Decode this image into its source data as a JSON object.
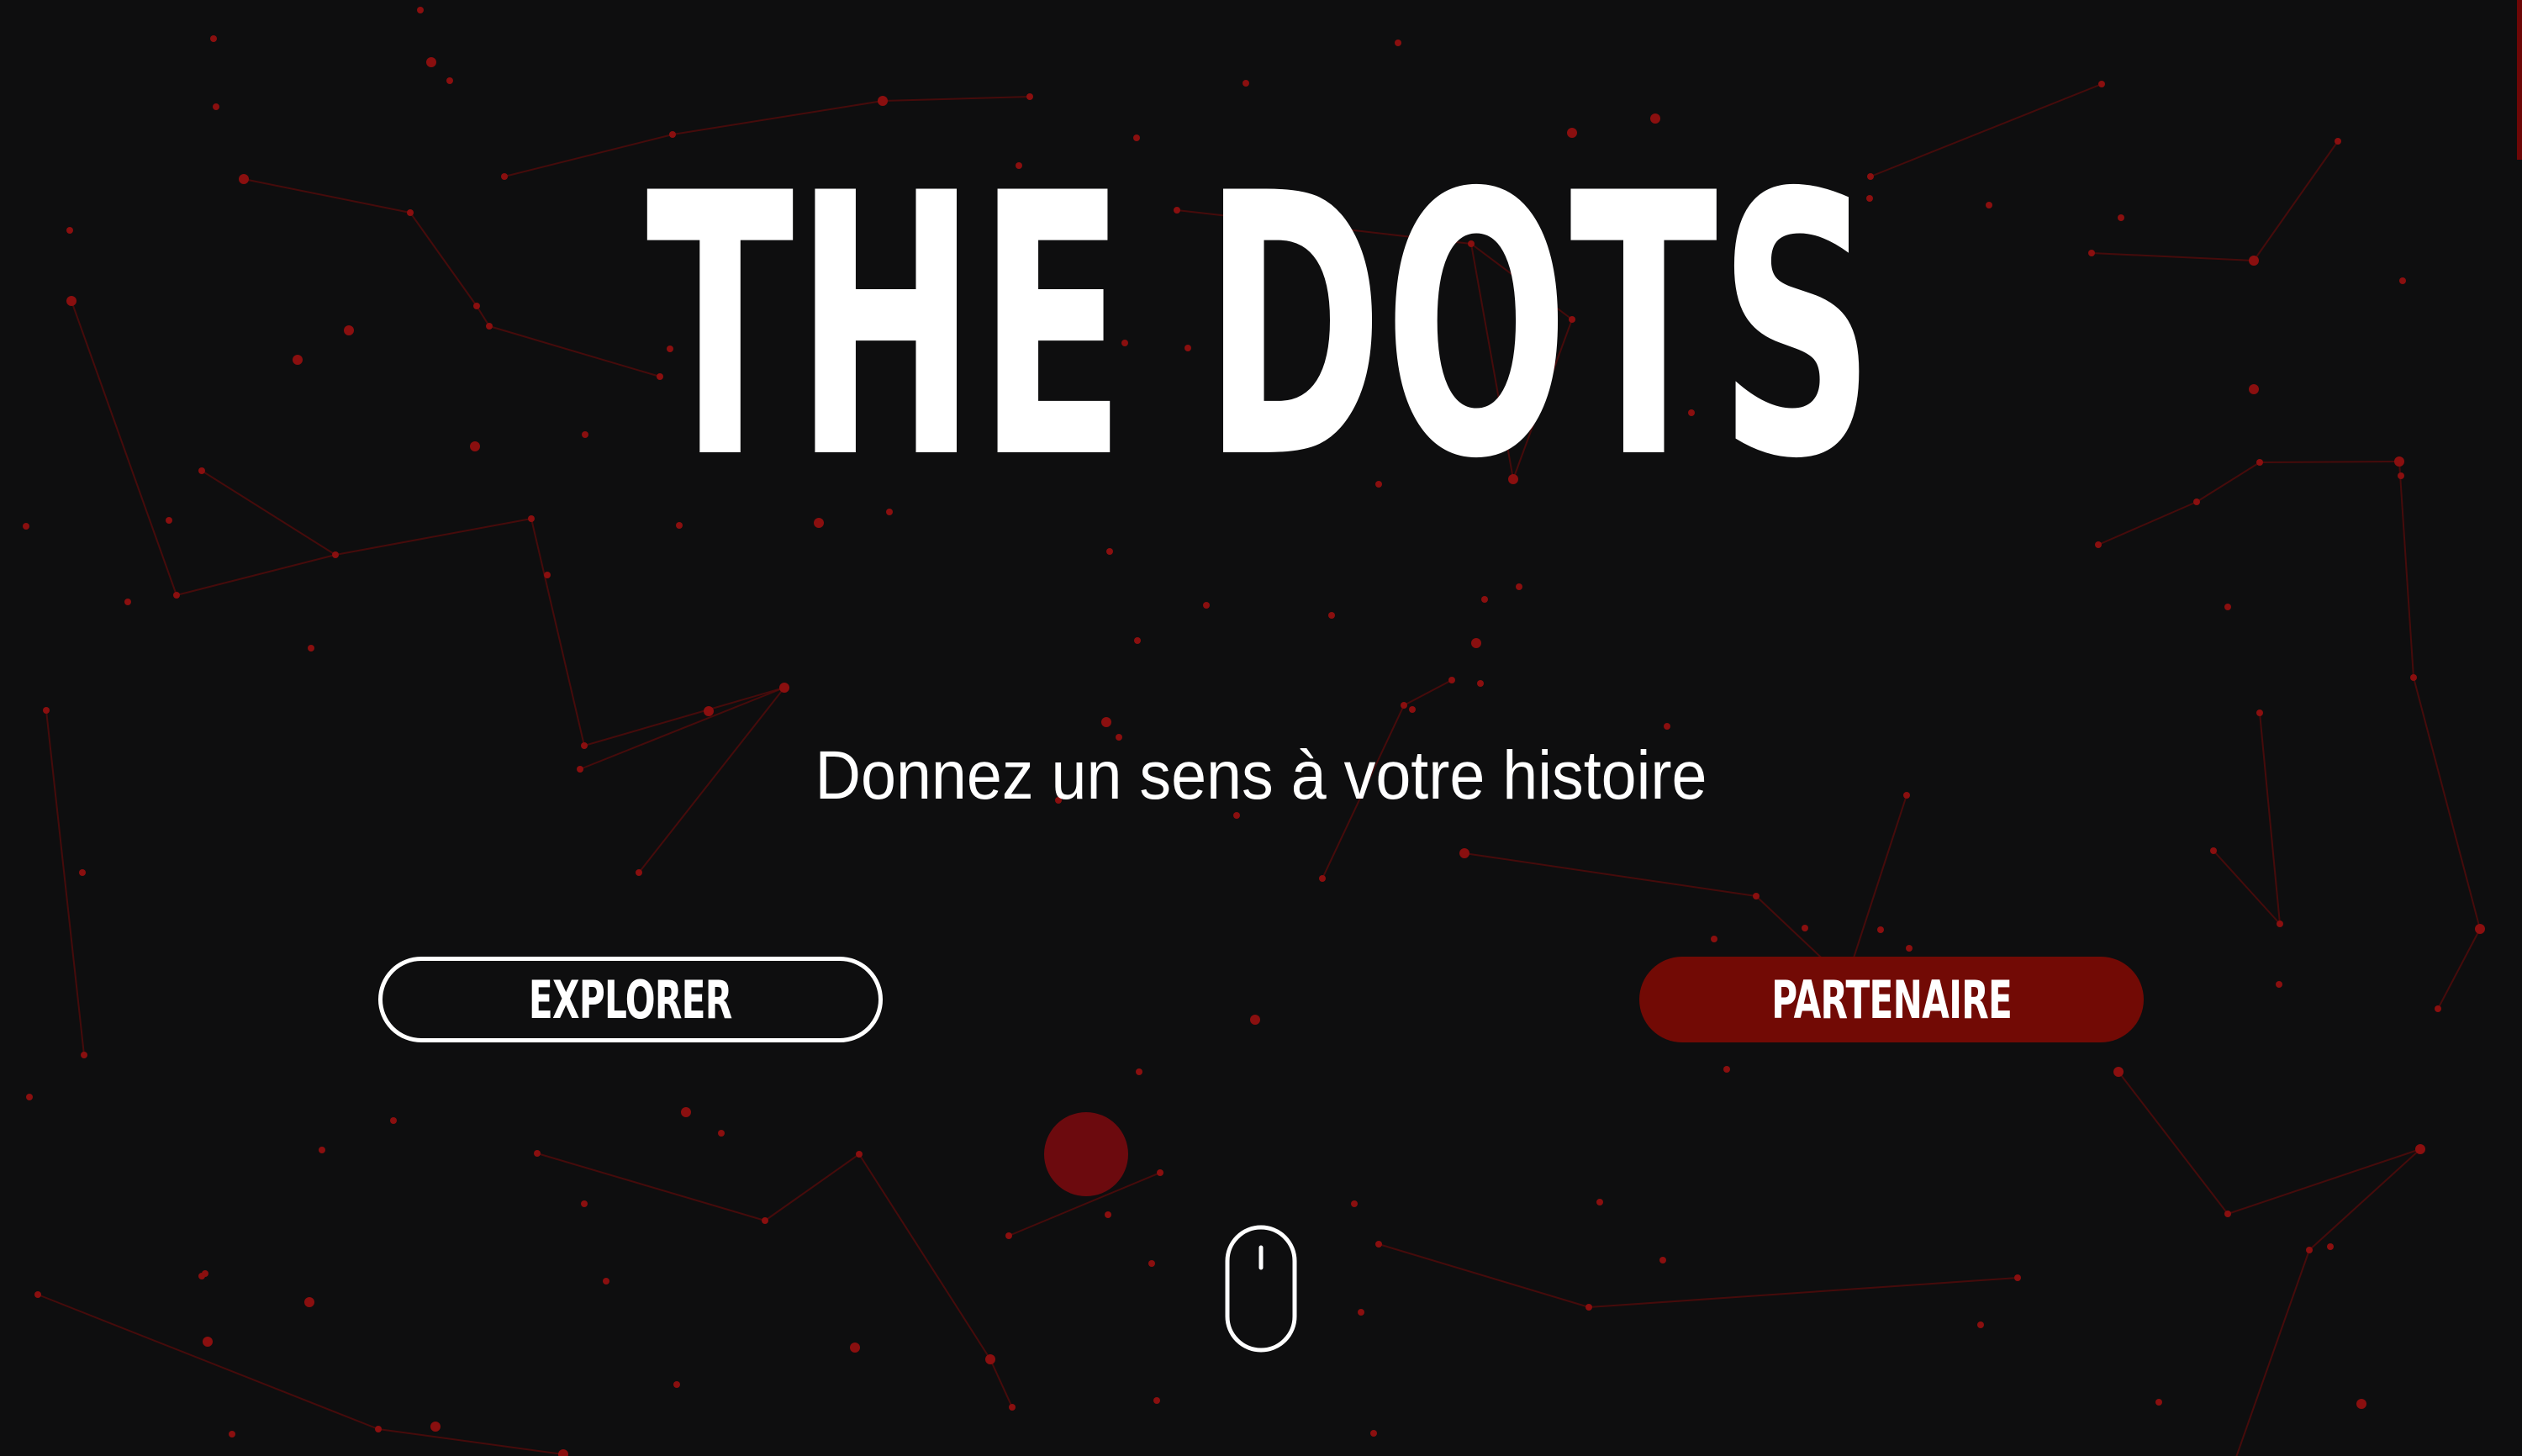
{
  "hero": {
    "title": "THE DOTS",
    "tagline": "Donnez un sens à votre histoire"
  },
  "actions": {
    "explore_label": "EXPLORER",
    "partner_label": "PARTENAIRE"
  },
  "scroll_hint": {
    "icon": "mouse-scroll-icon"
  },
  "colors": {
    "background": "#0e0e0f",
    "accent": "#720a05",
    "dot": "#8a0f0f",
    "text": "#ffffff"
  }
}
